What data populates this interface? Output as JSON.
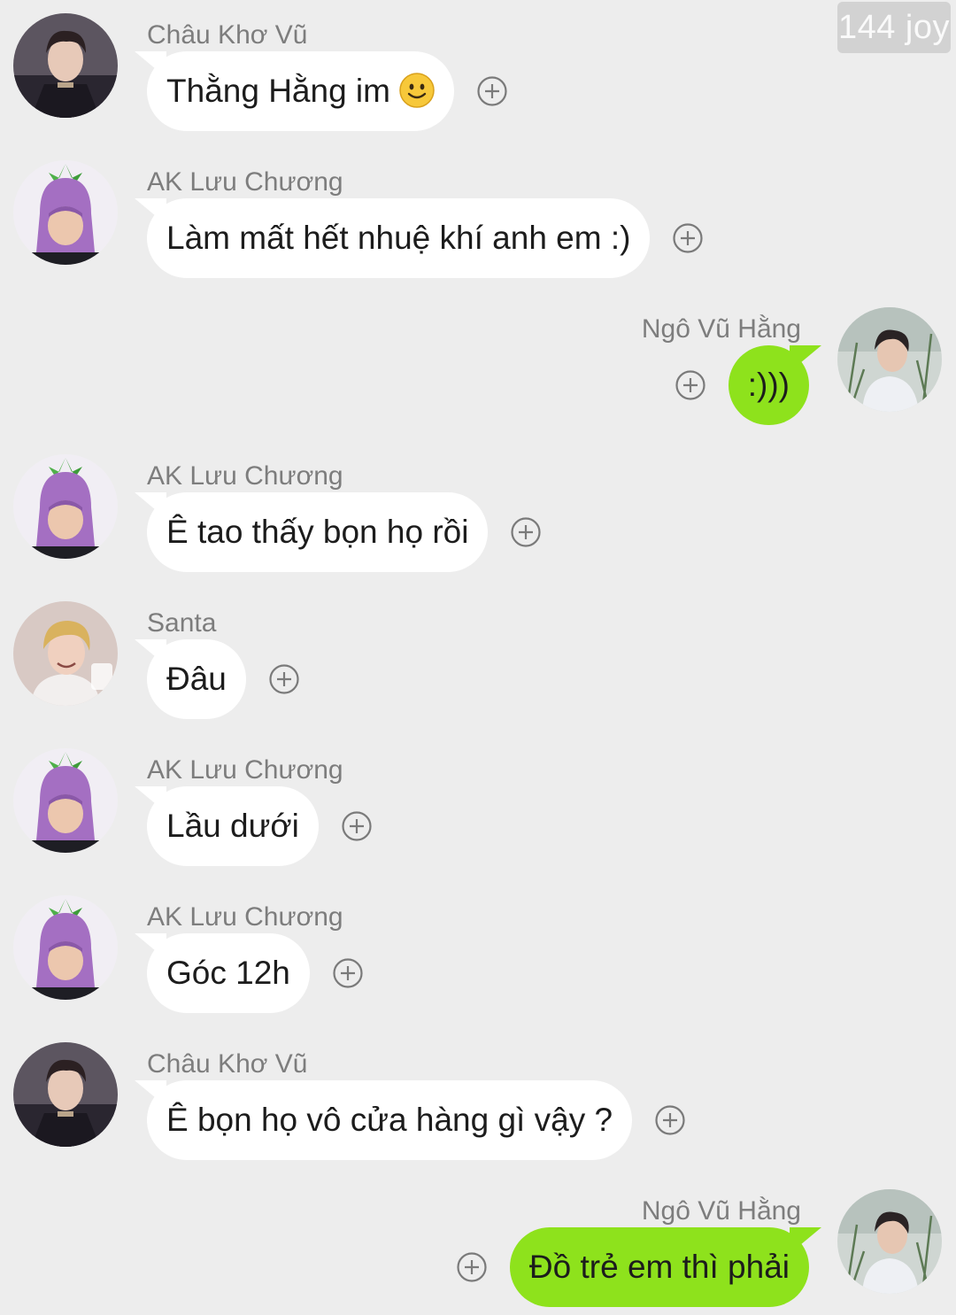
{
  "watermark": "144 joy",
  "messages": [
    {
      "sender": "Châu Khơ Vũ",
      "text": "Thằng Hằng im",
      "emoji": "slightly-smiling-face-icon",
      "side": "left",
      "avatar": "photo-dark-jacket"
    },
    {
      "sender": "AK Lưu Chương",
      "text": "Làm mất hết nhuệ khí anh em :)",
      "side": "left",
      "avatar": "photo-eggplant-hat"
    },
    {
      "sender": "Ngô Vũ Hằng",
      "text": ":)))",
      "side": "right",
      "avatar": "photo-grass-outdoor"
    },
    {
      "sender": "AK Lưu Chương",
      "text": "Ê tao thấy bọn họ rồi",
      "side": "left",
      "avatar": "photo-eggplant-hat"
    },
    {
      "sender": "Santa",
      "text": "Đâu",
      "side": "left",
      "avatar": "photo-blond-hair"
    },
    {
      "sender": "AK Lưu Chương",
      "text": "Lầu dưới",
      "side": "left",
      "avatar": "photo-eggplant-hat"
    },
    {
      "sender": "AK Lưu Chương",
      "text": "Góc 12h",
      "side": "left",
      "avatar": "photo-eggplant-hat"
    },
    {
      "sender": "Châu Khơ Vũ",
      "text": "Ê bọn họ vô cửa hàng gì vậy ?",
      "side": "left",
      "avatar": "photo-dark-jacket"
    },
    {
      "sender": "Ngô Vũ Hằng",
      "text": "Đồ trẻ em thì phải",
      "side": "right",
      "avatar": "photo-grass-outdoor"
    }
  ],
  "colors": {
    "background": "#ededed",
    "incoming_bubble": "#ffffff",
    "outgoing_bubble": "#8ee21c",
    "sender_name": "#7d7d7d",
    "plus_icon": "#7a7a7a"
  }
}
